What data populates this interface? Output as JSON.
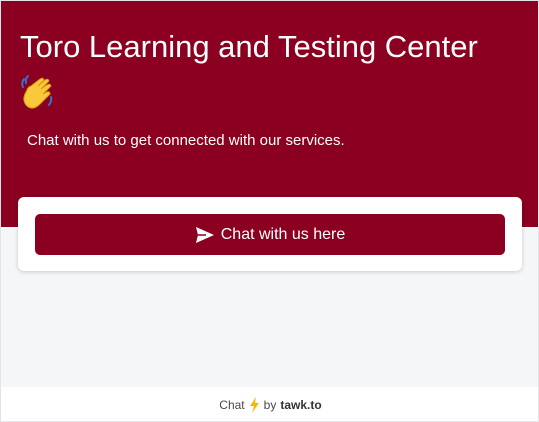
{
  "header": {
    "title": "Toro Learning and Testing Center",
    "subtitle": "Chat with us to get connected with our services."
  },
  "card": {
    "button_label": "Chat with us here"
  },
  "footer": {
    "chat_text": "Chat",
    "by_text": "by",
    "brand": "tawk.to"
  },
  "icons": {
    "wave": "waving-hand-icon",
    "send": "send-icon",
    "bolt": "lightning-bolt-icon"
  },
  "colors": {
    "brand": "#8b0020",
    "background": "#f5f6f8",
    "bolt": "#f5b800"
  }
}
